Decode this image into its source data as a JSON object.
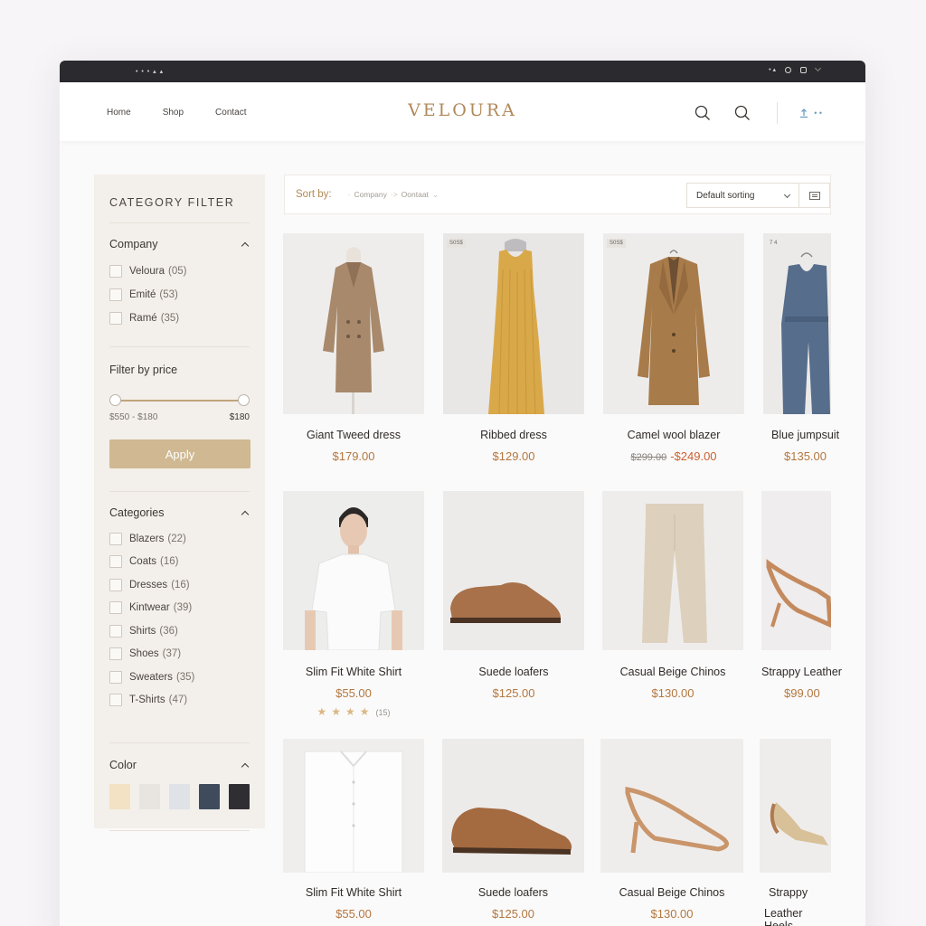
{
  "browser": {
    "left_text": "• • • ▴ ▴",
    "right_text": "• ▴"
  },
  "header": {
    "nav": [
      "Home",
      "Shop",
      "Contact"
    ],
    "logo": "VELOURA",
    "account_text": "• •"
  },
  "sidebar": {
    "title": "CATEGORY FILTER",
    "company": {
      "heading": "Company",
      "items": [
        {
          "label": "Veloura",
          "count": "(05)"
        },
        {
          "label": "Emité",
          "count": "(53)"
        },
        {
          "label": "Ramé",
          "count": "(35)"
        }
      ]
    },
    "price": {
      "heading": "Filter by price",
      "range_label": "$550 - $180",
      "max_label": "$180",
      "apply_label": "Apply"
    },
    "categories": {
      "heading": "Categories",
      "items": [
        {
          "label": "Blazers",
          "count": "(22)"
        },
        {
          "label": "Coats",
          "count": "(16)"
        },
        {
          "label": "Dresses",
          "count": "(16)"
        },
        {
          "label": "Kintwear",
          "count": "(39)"
        },
        {
          "label": "Shirts",
          "count": "(36)"
        },
        {
          "label": "Shoes",
          "count": "(37)"
        },
        {
          "label": "Sweaters",
          "count": "(35)"
        },
        {
          "label": "T-Shirts",
          "count": "(47)"
        }
      ]
    },
    "color": {
      "heading": "Color",
      "swatches": [
        "#f3e2c3",
        "#e8e4df",
        "#dfe2e7",
        "#3f4a5c",
        "#2f2e33"
      ]
    }
  },
  "toolbar": {
    "sort_by_label": "Sort by:",
    "crumb_1": "Company",
    "crumb_2": "Oontaat",
    "sort_select": "Default sorting"
  },
  "products": [
    {
      "name": "Giant Tweed dress",
      "price": "$179.00",
      "badge": ""
    },
    {
      "name": "Ribbed dress",
      "price": "$129.00",
      "badge": "S0S$"
    },
    {
      "name": "Camel wool blazer",
      "old_price": "$299.00",
      "price": "-$249.00",
      "badge": "S0S$"
    },
    {
      "name": "Blue jumpsuit",
      "price": "$135.00",
      "badge": "7 4"
    },
    {
      "name": "Slim Fit White Shirt",
      "price": "$55.00",
      "rating": 4,
      "review_count": "(15)"
    },
    {
      "name": "Suede loafers",
      "price": "$125.00"
    },
    {
      "name": "Casual Beige Chinos",
      "price": "$130.00"
    },
    {
      "name": "Strappy Leather",
      "price": "$99.00"
    },
    {
      "name": "Slim Fit White Shirt",
      "price": "$55.00"
    },
    {
      "name": "Suede loafers",
      "price": "$125.00"
    },
    {
      "name": "Casual Beige Chinos",
      "price": "$130.00"
    },
    {
      "name": "Strappy",
      "price": "Leather Heels"
    }
  ],
  "icons": {
    "search": "search-icon",
    "search_alt": "search-icon",
    "account": "account-icon",
    "view": "grid-view-icon"
  }
}
